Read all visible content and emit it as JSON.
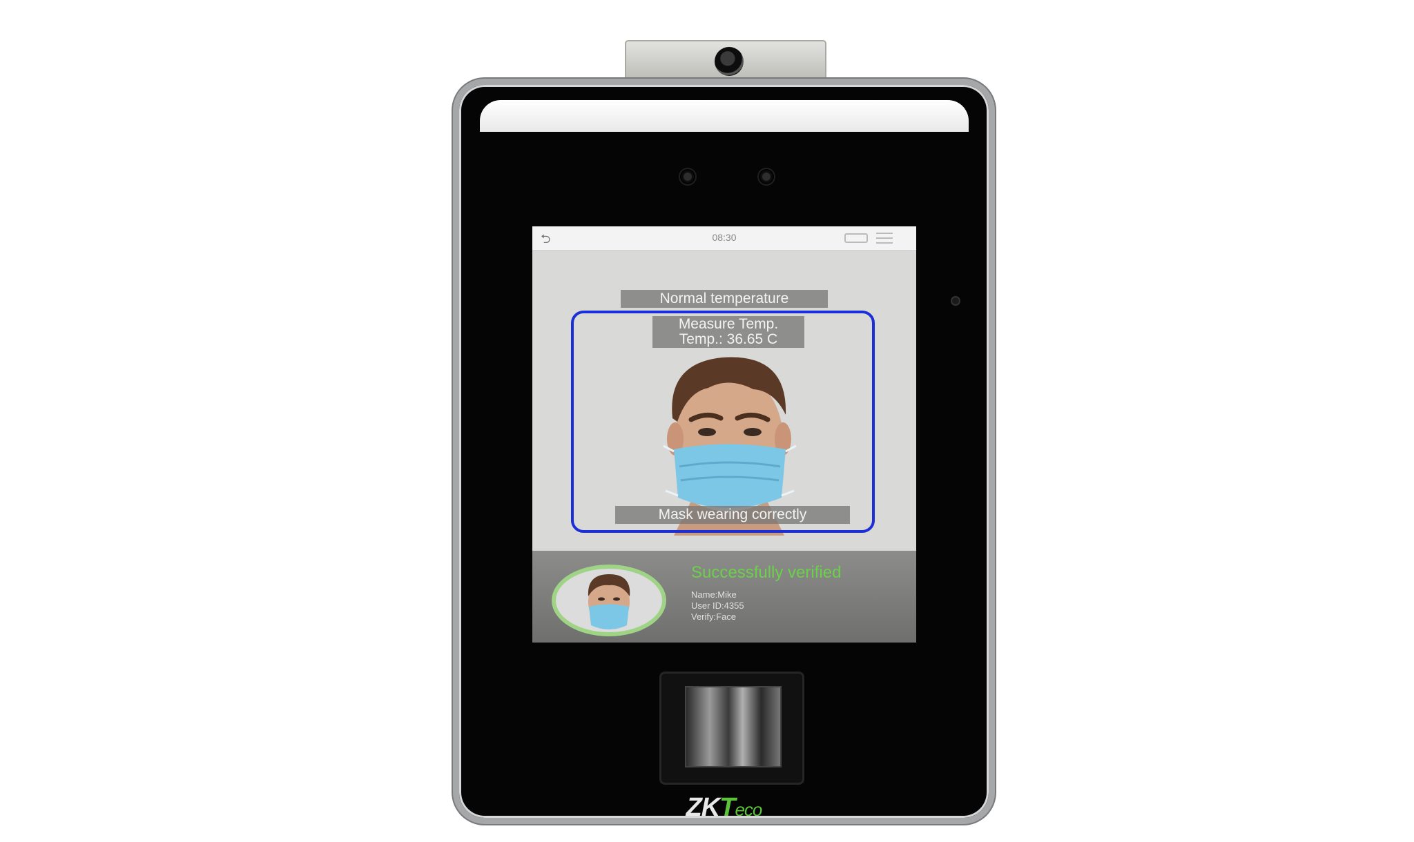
{
  "device": {
    "brand_zk": "ZK",
    "brand_t": "T",
    "brand_eco": "eco"
  },
  "screen": {
    "status_bar": {
      "time": "08:30",
      "back_icon": "back-arrow-icon",
      "network_icon": "network-icon",
      "menu_icon": "menu-icon"
    },
    "temperature_status": "Normal temperature",
    "measure_label": "Measure Temp.",
    "temp_reading": "Temp.: 36.65 C",
    "mask_status": "Mask wearing correctly",
    "verification": {
      "result": "Successfully verified",
      "name": "Name:Mike",
      "user_id": "User ID:4355",
      "verify_mode": "Verify:Face"
    }
  },
  "colors": {
    "face_box": "#1a2fd8",
    "success_green": "#6cd04a",
    "brand_green": "#5cc23a"
  }
}
